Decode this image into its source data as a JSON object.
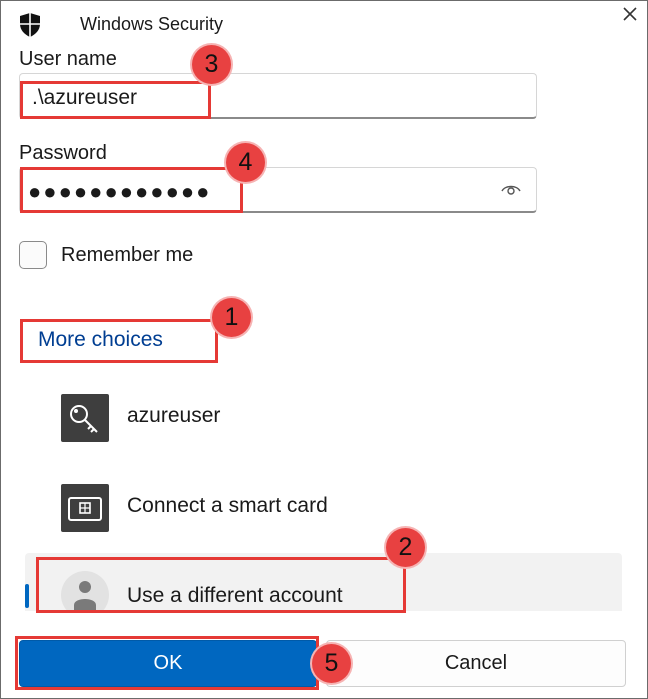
{
  "window": {
    "title": "Windows Security"
  },
  "form": {
    "username_label": "User name",
    "username_value": ".\\azureuser",
    "password_label": "Password",
    "password_value": "●●●●●●●●●●●●",
    "remember_label": "Remember me",
    "more_choices": "More choices"
  },
  "options": [
    {
      "label": "azureuser",
      "icon": "key-icon"
    },
    {
      "label": "Connect a smart card",
      "icon": "smart-card-icon"
    },
    {
      "label": "Use a different account",
      "icon": "person-icon"
    }
  ],
  "buttons": {
    "ok": "OK",
    "cancel": "Cancel"
  },
  "callouts": [
    "1",
    "2",
    "3",
    "4",
    "5"
  ],
  "colors": {
    "accent": "#0067c0",
    "link": "#003e92",
    "callout": "#e53935",
    "tile": "#3e3e3e"
  }
}
